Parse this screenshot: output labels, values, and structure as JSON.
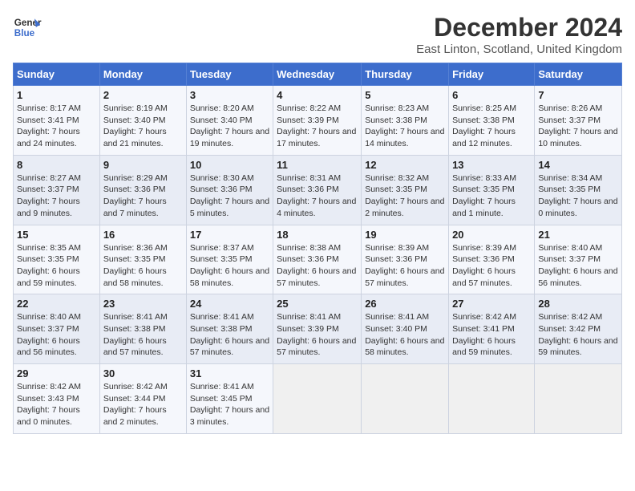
{
  "header": {
    "logo_line1": "General",
    "logo_line2": "Blue",
    "month_year": "December 2024",
    "location": "East Linton, Scotland, United Kingdom"
  },
  "days_of_week": [
    "Sunday",
    "Monday",
    "Tuesday",
    "Wednesday",
    "Thursday",
    "Friday",
    "Saturday"
  ],
  "weeks": [
    [
      {
        "day": "1",
        "sunrise": "Sunrise: 8:17 AM",
        "sunset": "Sunset: 3:41 PM",
        "daylight": "Daylight: 7 hours and 24 minutes."
      },
      {
        "day": "2",
        "sunrise": "Sunrise: 8:19 AM",
        "sunset": "Sunset: 3:40 PM",
        "daylight": "Daylight: 7 hours and 21 minutes."
      },
      {
        "day": "3",
        "sunrise": "Sunrise: 8:20 AM",
        "sunset": "Sunset: 3:40 PM",
        "daylight": "Daylight: 7 hours and 19 minutes."
      },
      {
        "day": "4",
        "sunrise": "Sunrise: 8:22 AM",
        "sunset": "Sunset: 3:39 PM",
        "daylight": "Daylight: 7 hours and 17 minutes."
      },
      {
        "day": "5",
        "sunrise": "Sunrise: 8:23 AM",
        "sunset": "Sunset: 3:38 PM",
        "daylight": "Daylight: 7 hours and 14 minutes."
      },
      {
        "day": "6",
        "sunrise": "Sunrise: 8:25 AM",
        "sunset": "Sunset: 3:38 PM",
        "daylight": "Daylight: 7 hours and 12 minutes."
      },
      {
        "day": "7",
        "sunrise": "Sunrise: 8:26 AM",
        "sunset": "Sunset: 3:37 PM",
        "daylight": "Daylight: 7 hours and 10 minutes."
      }
    ],
    [
      {
        "day": "8",
        "sunrise": "Sunrise: 8:27 AM",
        "sunset": "Sunset: 3:37 PM",
        "daylight": "Daylight: 7 hours and 9 minutes."
      },
      {
        "day": "9",
        "sunrise": "Sunrise: 8:29 AM",
        "sunset": "Sunset: 3:36 PM",
        "daylight": "Daylight: 7 hours and 7 minutes."
      },
      {
        "day": "10",
        "sunrise": "Sunrise: 8:30 AM",
        "sunset": "Sunset: 3:36 PM",
        "daylight": "Daylight: 7 hours and 5 minutes."
      },
      {
        "day": "11",
        "sunrise": "Sunrise: 8:31 AM",
        "sunset": "Sunset: 3:36 PM",
        "daylight": "Daylight: 7 hours and 4 minutes."
      },
      {
        "day": "12",
        "sunrise": "Sunrise: 8:32 AM",
        "sunset": "Sunset: 3:35 PM",
        "daylight": "Daylight: 7 hours and 2 minutes."
      },
      {
        "day": "13",
        "sunrise": "Sunrise: 8:33 AM",
        "sunset": "Sunset: 3:35 PM",
        "daylight": "Daylight: 7 hours and 1 minute."
      },
      {
        "day": "14",
        "sunrise": "Sunrise: 8:34 AM",
        "sunset": "Sunset: 3:35 PM",
        "daylight": "Daylight: 7 hours and 0 minutes."
      }
    ],
    [
      {
        "day": "15",
        "sunrise": "Sunrise: 8:35 AM",
        "sunset": "Sunset: 3:35 PM",
        "daylight": "Daylight: 6 hours and 59 minutes."
      },
      {
        "day": "16",
        "sunrise": "Sunrise: 8:36 AM",
        "sunset": "Sunset: 3:35 PM",
        "daylight": "Daylight: 6 hours and 58 minutes."
      },
      {
        "day": "17",
        "sunrise": "Sunrise: 8:37 AM",
        "sunset": "Sunset: 3:35 PM",
        "daylight": "Daylight: 6 hours and 58 minutes."
      },
      {
        "day": "18",
        "sunrise": "Sunrise: 8:38 AM",
        "sunset": "Sunset: 3:36 PM",
        "daylight": "Daylight: 6 hours and 57 minutes."
      },
      {
        "day": "19",
        "sunrise": "Sunrise: 8:39 AM",
        "sunset": "Sunset: 3:36 PM",
        "daylight": "Daylight: 6 hours and 57 minutes."
      },
      {
        "day": "20",
        "sunrise": "Sunrise: 8:39 AM",
        "sunset": "Sunset: 3:36 PM",
        "daylight": "Daylight: 6 hours and 57 minutes."
      },
      {
        "day": "21",
        "sunrise": "Sunrise: 8:40 AM",
        "sunset": "Sunset: 3:37 PM",
        "daylight": "Daylight: 6 hours and 56 minutes."
      }
    ],
    [
      {
        "day": "22",
        "sunrise": "Sunrise: 8:40 AM",
        "sunset": "Sunset: 3:37 PM",
        "daylight": "Daylight: 6 hours and 56 minutes."
      },
      {
        "day": "23",
        "sunrise": "Sunrise: 8:41 AM",
        "sunset": "Sunset: 3:38 PM",
        "daylight": "Daylight: 6 hours and 57 minutes."
      },
      {
        "day": "24",
        "sunrise": "Sunrise: 8:41 AM",
        "sunset": "Sunset: 3:38 PM",
        "daylight": "Daylight: 6 hours and 57 minutes."
      },
      {
        "day": "25",
        "sunrise": "Sunrise: 8:41 AM",
        "sunset": "Sunset: 3:39 PM",
        "daylight": "Daylight: 6 hours and 57 minutes."
      },
      {
        "day": "26",
        "sunrise": "Sunrise: 8:41 AM",
        "sunset": "Sunset: 3:40 PM",
        "daylight": "Daylight: 6 hours and 58 minutes."
      },
      {
        "day": "27",
        "sunrise": "Sunrise: 8:42 AM",
        "sunset": "Sunset: 3:41 PM",
        "daylight": "Daylight: 6 hours and 59 minutes."
      },
      {
        "day": "28",
        "sunrise": "Sunrise: 8:42 AM",
        "sunset": "Sunset: 3:42 PM",
        "daylight": "Daylight: 6 hours and 59 minutes."
      }
    ],
    [
      {
        "day": "29",
        "sunrise": "Sunrise: 8:42 AM",
        "sunset": "Sunset: 3:43 PM",
        "daylight": "Daylight: 7 hours and 0 minutes."
      },
      {
        "day": "30",
        "sunrise": "Sunrise: 8:42 AM",
        "sunset": "Sunset: 3:44 PM",
        "daylight": "Daylight: 7 hours and 2 minutes."
      },
      {
        "day": "31",
        "sunrise": "Sunrise: 8:41 AM",
        "sunset": "Sunset: 3:45 PM",
        "daylight": "Daylight: 7 hours and 3 minutes."
      },
      null,
      null,
      null,
      null
    ]
  ]
}
